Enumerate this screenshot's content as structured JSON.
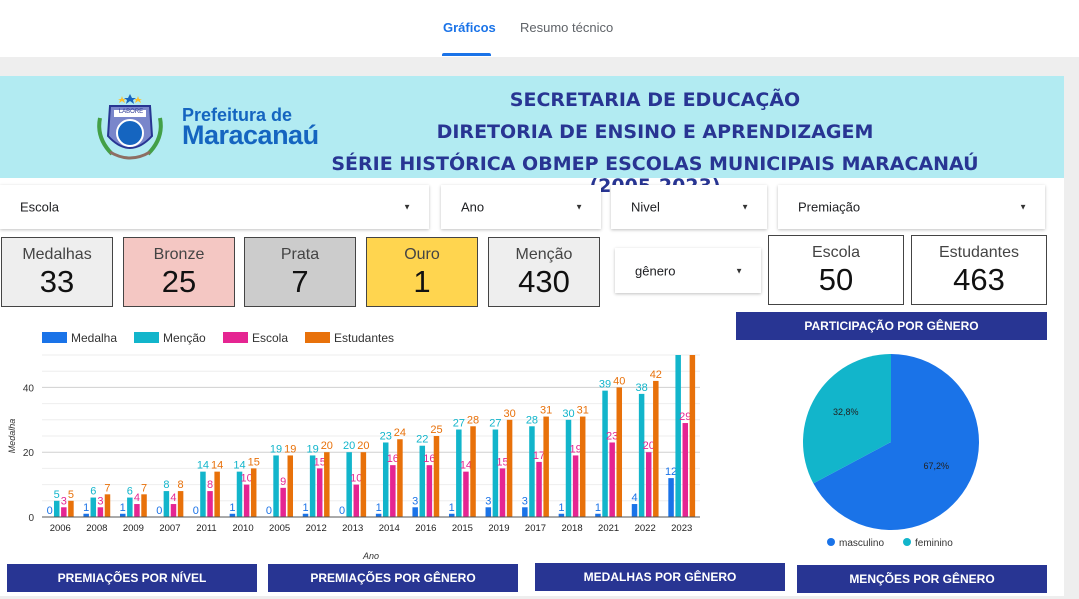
{
  "tabs": [
    {
      "label": "Gráficos",
      "active": true
    },
    {
      "label": "Resumo técnico",
      "active": false
    }
  ],
  "header": {
    "line1": "SECRETARIA DE EDUCAÇÃO",
    "line2": "DIRETORIA DE ENSINO E APRENDIZAGEM",
    "line3": "SÉRIE HISTÓRICA OBMEP ESCOLAS MUNICIPAIS MARACANAÚ (2005-2023)",
    "logo_line1": "Prefeitura de",
    "logo_line2": "Maracanaú",
    "logo_badge": "LABORE",
    "color": "#283593"
  },
  "filters": {
    "escola": "Escola",
    "ano": "Ano",
    "nivel": "Nivel",
    "premiacao": "Premiação",
    "genero": "gênero"
  },
  "kpis": [
    {
      "label": "Medalhas",
      "value": "33",
      "bg": "#eeeeee"
    },
    {
      "label": "Bronze",
      "value": "25",
      "bg": "#f4c7c3"
    },
    {
      "label": "Prata",
      "value": "7",
      "bg": "#cccccc"
    },
    {
      "label": "Ouro",
      "value": "1",
      "bg": "#ffd54f"
    },
    {
      "label": "Menção",
      "value": "430",
      "bg": "#eeeeee"
    },
    {
      "label": "Escola",
      "value": "50",
      "bg": "#ffffff"
    },
    {
      "label": "Estudantes",
      "value": "463",
      "bg": "#ffffff"
    }
  ],
  "section_buttons": {
    "participacao": "PARTICIPAÇÃO POR GÊNERO",
    "premiacoes_nivel": "PREMIAÇÕES POR NÍVEL",
    "premiacoes_genero": "PREMIAÇÕES POR GÊNERO",
    "medalhas_genero": "MEDALHAS POR GÊNERO",
    "mencoes_genero": "MENÇÕES POR GÊNERO"
  },
  "chart_data": [
    {
      "type": "bar",
      "ylabel": "Medalha",
      "xlabel": "Ano",
      "ylim": [
        0,
        50
      ],
      "yticks": [
        0,
        20,
        40
      ],
      "grid": true,
      "legend_position": "top-left",
      "categories": [
        "2006",
        "2008",
        "2009",
        "2007",
        "2011",
        "2010",
        "2005",
        "2012",
        "2013",
        "2014",
        "2016",
        "2015",
        "2019",
        "2017",
        "2018",
        "2021",
        "2022",
        "2023"
      ],
      "series": [
        {
          "name": "Medalha",
          "color": "#1a73e8",
          "values": [
            0,
            1,
            1,
            0,
            0,
            1,
            0,
            1,
            0,
            1,
            3,
            1,
            3,
            3,
            1,
            1,
            4,
            12
          ]
        },
        {
          "name": "Menção",
          "color": "#12b5cb",
          "values": [
            5,
            6,
            6,
            8,
            14,
            14,
            19,
            19,
            20,
            23,
            22,
            27,
            27,
            28,
            30,
            39,
            38,
            50
          ]
        },
        {
          "name": "Escola",
          "color": "#e52592",
          "values": [
            3,
            3,
            4,
            4,
            8,
            10,
            9,
            15,
            10,
            16,
            16,
            14,
            15,
            17,
            19,
            23,
            20,
            29
          ]
        },
        {
          "name": "Estudantes",
          "color": "#e8710a",
          "values": [
            5,
            7,
            7,
            8,
            14,
            15,
            19,
            20,
            20,
            24,
            25,
            28,
            30,
            31,
            31,
            40,
            42,
            50
          ]
        }
      ],
      "labels_hidden": {
        "Menção_2023": true,
        "Estudantes_2023": true
      }
    },
    {
      "type": "pie",
      "slices": [
        {
          "name": "masculino",
          "value": 67.2,
          "label": "67,2%",
          "color": "#1a73e8"
        },
        {
          "name": "feminino",
          "value": 32.8,
          "label": "32,8%",
          "color": "#12b5cb"
        }
      ],
      "legend_position": "bottom"
    }
  ]
}
